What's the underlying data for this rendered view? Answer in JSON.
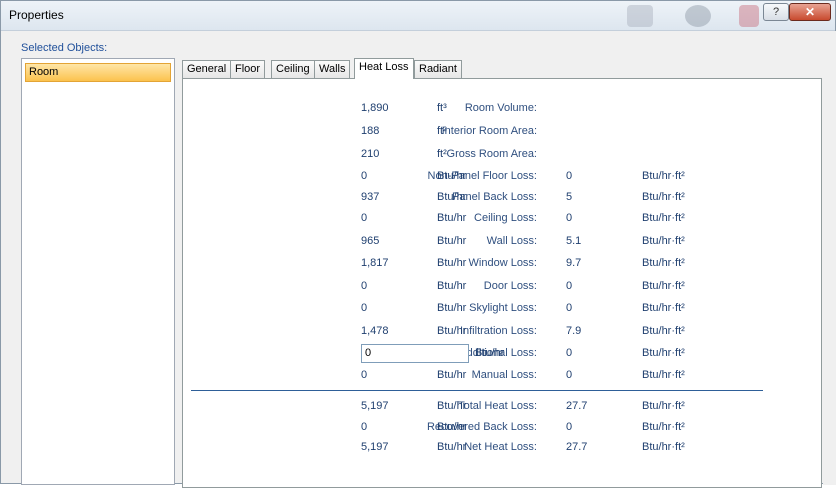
{
  "window": {
    "title": "Properties"
  },
  "titlebar": {
    "help": "?",
    "close": "✕"
  },
  "selected_objects": {
    "label": "Selected Objects:",
    "items": [
      "Room"
    ]
  },
  "tabs": [
    "General",
    "Floor",
    "Ceiling",
    "Walls",
    "Heat Loss",
    "Radiant"
  ],
  "active_tab": "Heat Loss",
  "heat_loss": {
    "room_volume": {
      "label": "Room Volume:",
      "value": "1,890",
      "unit": "ft³"
    },
    "interior_room_area": {
      "label": "Interior Room Area:",
      "value": "188",
      "unit": "ft²"
    },
    "gross_room_area": {
      "label": "Gross Room Area:",
      "value": "210",
      "unit": "ft²"
    },
    "rows": [
      {
        "label": "Non-Panel Floor Loss:",
        "value": "0",
        "unit": "Btu/hr",
        "density": "0",
        "density_unit": "Btu/hr·ft²"
      },
      {
        "label": "Panel Back Loss:",
        "value": "937",
        "unit": "Btu/hr",
        "density": "5",
        "density_unit": "Btu/hr·ft²"
      },
      {
        "label": "Ceiling Loss:",
        "value": "0",
        "unit": "Btu/hr",
        "density": "0",
        "density_unit": "Btu/hr·ft²"
      },
      {
        "label": "Wall Loss:",
        "value": "965",
        "unit": "Btu/hr",
        "density": "5.1",
        "density_unit": "Btu/hr·ft²"
      },
      {
        "label": "Window Loss:",
        "value": "1,817",
        "unit": "Btu/hr",
        "density": "9.7",
        "density_unit": "Btu/hr·ft²"
      },
      {
        "label": "Door Loss:",
        "value": "0",
        "unit": "Btu/hr",
        "density": "0",
        "density_unit": "Btu/hr·ft²"
      },
      {
        "label": "Skylight Loss:",
        "value": "0",
        "unit": "Btu/hr",
        "density": "0",
        "density_unit": "Btu/hr·ft²"
      },
      {
        "label": "Infiltration Loss:",
        "value": "1,478",
        "unit": "Btu/hr",
        "density": "7.9",
        "density_unit": "Btu/hr·ft²"
      }
    ],
    "additional_loss": {
      "label": "Additional Loss:",
      "value": "0",
      "unit": "Btu/hr",
      "density": "0",
      "density_unit": "Btu/hr·ft²"
    },
    "manual_loss": {
      "label": "Manual Loss:",
      "value": "0",
      "unit": "Btu/hr",
      "density": "0",
      "density_unit": "Btu/hr·ft²"
    },
    "totals": [
      {
        "label": "Total Heat Loss:",
        "value": "5,197",
        "unit": "Btu/hr",
        "density": "27.7",
        "density_unit": "Btu/hr·ft²"
      },
      {
        "label": "Recovered Back Loss:",
        "value": "0",
        "unit": "Btu/hr",
        "density": "0",
        "density_unit": "Btu/hr·ft²"
      },
      {
        "label": "Net Heat Loss:",
        "value": "5,197",
        "unit": "Btu/hr",
        "density": "27.7",
        "density_unit": "Btu/hr·ft²"
      }
    ]
  }
}
